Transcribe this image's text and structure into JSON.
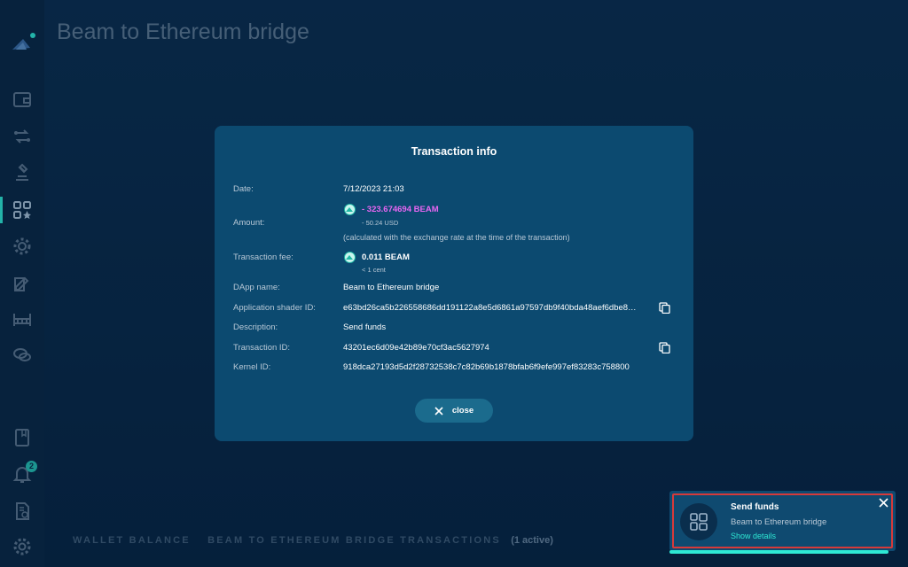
{
  "header": {
    "title": "Beam to Ethereum bridge"
  },
  "sidebar": {
    "notification_count": "2",
    "items": [
      {
        "icon": "wallet-icon"
      },
      {
        "icon": "swap-icon"
      },
      {
        "icon": "dao-icon"
      },
      {
        "icon": "dapp-store-icon"
      },
      {
        "icon": "settings-gear-icon"
      },
      {
        "icon": "edit-icon"
      },
      {
        "icon": "bridge-icon"
      },
      {
        "icon": "chat-icon"
      },
      {
        "icon": "notebook-icon"
      },
      {
        "icon": "bell-icon"
      },
      {
        "icon": "document-icon"
      },
      {
        "icon": "gear-icon"
      }
    ]
  },
  "tabs": {
    "wallet_balance": "WALLET BALANCE",
    "transactions": "BEAM TO ETHEREUM BRIDGE TRANSACTIONS",
    "active_count": "(1 active)"
  },
  "modal": {
    "title": "Transaction info",
    "date_label": "Date:",
    "date_value": "7/12/2023  21:03",
    "amount_label": "Amount:",
    "amount_value": "- 323.674694  BEAM",
    "amount_usd": "- 50.24 USD",
    "amount_note": "(calculated with the exchange rate at the time of the transaction)",
    "fee_label": "Transaction fee:",
    "fee_value": "0.011  BEAM",
    "fee_usd": "< 1 cent",
    "dapp_label": "DApp name:",
    "dapp_value": "Beam to Ethereum bridge",
    "shader_label": "Application shader ID:",
    "shader_value": "e63bd26ca5b226558686dd191122a8e5d6861a97597db9f40bda48aef6dbe8…",
    "desc_label": "Description:",
    "desc_value": "Send funds",
    "txid_label": "Transaction ID:",
    "txid_value": "43201ec6d09e42b89e70cf3ac5627974",
    "kernel_label": "Kernel ID:",
    "kernel_value": "918dca27193d5d2f28732538c7c82b69b1878bfab6f9efe997ef83283c758800",
    "close_label": "close"
  },
  "toast": {
    "title": "Send funds",
    "subtitle": "Beam to Ethereum bridge",
    "link": "Show details",
    "progress": 0.97
  },
  "colors": {
    "accent": "#2ee8d4",
    "amount": "#e866f2",
    "modal_bg": "#0c4a70",
    "highlight": "#d63a3a"
  }
}
